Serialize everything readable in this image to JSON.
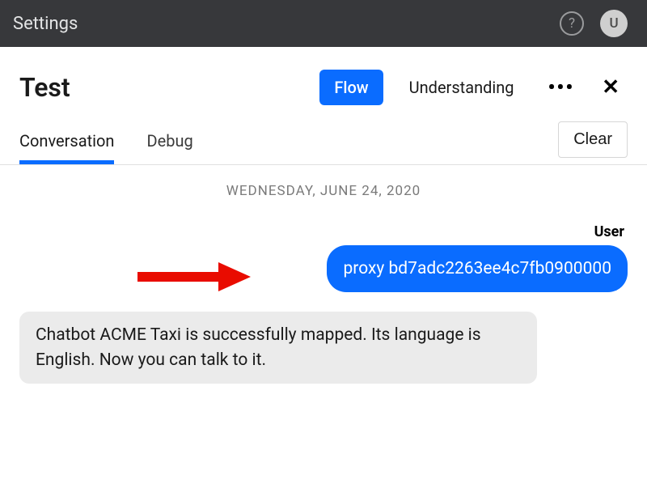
{
  "topbar": {
    "title": "Settings",
    "avatar_initial": "U"
  },
  "page": {
    "title": "Test",
    "toolbar": {
      "flow_label": "Flow",
      "understanding_label": "Understanding"
    }
  },
  "tabs": {
    "conversation_label": "Conversation",
    "debug_label": "Debug",
    "clear_label": "Clear"
  },
  "chat": {
    "date_label": "WEDNESDAY, JUNE 24, 2020",
    "user_sender_label": "User",
    "user_message": "proxy bd7adc2263ee4c7fb0900000",
    "bot_message": "Chatbot ACME Taxi is successfully mapped. Its language is English. Now you can talk to it."
  }
}
